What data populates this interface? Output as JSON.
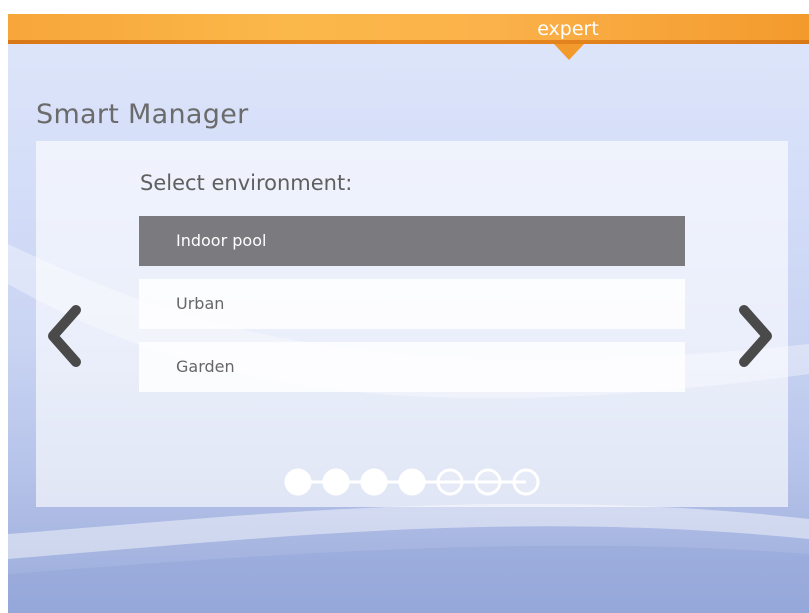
{
  "header": {
    "mode_label": "expert"
  },
  "page": {
    "title": "Smart Manager"
  },
  "panel": {
    "prompt": "Select environment:",
    "options": [
      {
        "label": "Indoor pool",
        "selected": true
      },
      {
        "label": "Urban",
        "selected": false
      },
      {
        "label": "Garden",
        "selected": false
      }
    ],
    "prev_icon": "chevron-left-icon",
    "next_icon": "chevron-right-icon"
  },
  "pager": {
    "total": 7,
    "filled": 4
  },
  "colors": {
    "accent_orange": "#f7a63a",
    "selected_bg": "#7a7a7f",
    "text_gray": "#6b6b6b",
    "arrow_gray": "#4a4a4a"
  }
}
